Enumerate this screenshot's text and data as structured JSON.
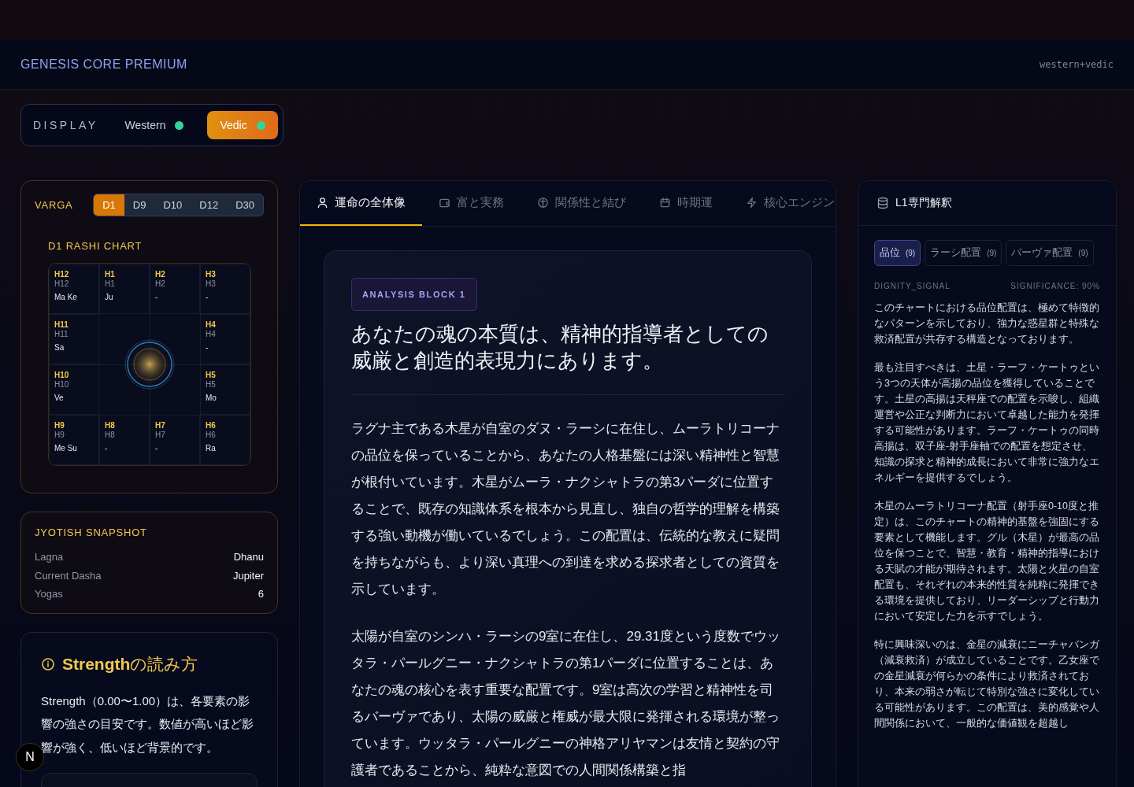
{
  "header": {
    "brand": "GENESIS CORE PREMIUM",
    "mode": "western+vedic"
  },
  "display": {
    "label": "DISPLAY",
    "options": [
      {
        "label": "Western",
        "selected": false,
        "color": "#34d399"
      },
      {
        "label": "Vedic",
        "selected": true,
        "color": "#34d399"
      }
    ]
  },
  "varga": {
    "label": "VARGA",
    "options": [
      {
        "label": "D1",
        "selected": true
      },
      {
        "label": "D9",
        "selected": false
      },
      {
        "label": "D10",
        "selected": false
      },
      {
        "label": "D12",
        "selected": false
      },
      {
        "label": "D30",
        "selected": false
      }
    ],
    "chart_title": "D1 RASHI CHART",
    "houses": [
      {
        "house": "H12",
        "sign": "H12",
        "planets": "Ma Ke"
      },
      {
        "house": "H1",
        "sign": "H1",
        "planets": "Ju"
      },
      {
        "house": "H2",
        "sign": "H2",
        "planets": "-"
      },
      {
        "house": "H3",
        "sign": "H3",
        "planets": "-"
      },
      {
        "house": "H11",
        "sign": "H11",
        "planets": "Sa"
      },
      {
        "house": "H4",
        "sign": "H4",
        "planets": "-"
      },
      {
        "house": "H10",
        "sign": "H10",
        "planets": "Ve"
      },
      {
        "house": "H5",
        "sign": "H5",
        "planets": "Mo"
      },
      {
        "house": "H9",
        "sign": "H9",
        "planets": "Me Su"
      },
      {
        "house": "H8",
        "sign": "H8",
        "planets": "-"
      },
      {
        "house": "H7",
        "sign": "H7",
        "planets": "-"
      },
      {
        "house": "H6",
        "sign": "H6",
        "planets": "Ra"
      }
    ]
  },
  "snapshot": {
    "title": "JYOTISH SNAPSHOT",
    "rows": [
      {
        "label": "Lagna",
        "value": "Dhanu"
      },
      {
        "label": "Current Dasha",
        "value": "Jupiter"
      },
      {
        "label": "Yogas",
        "value": "6"
      }
    ]
  },
  "strength": {
    "title": "**Strength**の読み方",
    "body": "Strength（0.00〜1.00）は、各要素の影響の強さの目安です。数値が高いほど影響が強く、低いほど背景的です。"
  },
  "tabs": [
    {
      "label": "運命の全体像",
      "selected": true
    },
    {
      "label": "富と実務",
      "selected": false
    },
    {
      "label": "関係性と結び",
      "selected": false
    },
    {
      "label": "時期運",
      "selected": false
    },
    {
      "label": "核心エンジン",
      "selected": false
    }
  ],
  "analysis": {
    "badge": "ANALYSIS BLOCK 1",
    "heading": "あなたの魂の本質は、精神的指導者としての威厳と創造的表現力にあります。",
    "paragraphs": [
      "ラグナ主である木星が自室のダヌ・ラーシに在住し、ムーラトリコーナの品位を保っていることから、あなたの人格基盤には深い精神性と智慧が根付いています。木星がムーラ・ナクシャトラの第3パーダに位置することで、既存の知識体系を根本から見直し、独自の哲学的理解を構築する強い動機が働いているでしょう。この配置は、伝統的な教えに疑問を持ちながらも、より深い真理への到達を求める探求者としての資質を示しています。",
      "太陽が自室のシンハ・ラーシの9室に在住し、29.31度という度数でウッタラ・パールグニー・ナクシャトラの第1パーダに位置することは、あなたの魂の核心を表す重要な配置です。9室は高次の学習と精神性を司るバーヴァであり、太陽の威厳と権威が最大限に発揮される環境が整っています。ウッタラ・パールグニーの神格アリヤマンは友情と契約の守護者であることから、純粋な意図での人間関係構築と指"
    ]
  },
  "expert": {
    "title": "L1専門解釈",
    "chips": [
      {
        "label": "品位",
        "count": "(9)",
        "selected": true
      },
      {
        "label": "ラーシ配置",
        "count": "(9)",
        "selected": false
      },
      {
        "label": "バーヴァ配置",
        "count": "(9)",
        "selected": false
      }
    ],
    "signal": "DIGNITY_SIGNAL",
    "significance": "SIGNIFICANCE: 90%",
    "paragraphs": [
      "このチャートにおける品位配置は、極めて特徴的なパターンを示しており、強力な惑星群と特殊な救済配置が共存する構造となっております。",
      "最も注目すべきは、土星・ラーフ・ケートゥという3つの天体が高揚の品位を獲得していることです。土星の高揚は天秤座での配置を示唆し、組織運営や公正な判断力において卓越した能力を発揮する可能性があります。ラーフ・ケートゥの同時高揚は、双子座-射手座軸での配置を想定させ、知識の探求と精神的成長において非常に強力なエネルギーを提供するでしょう。",
      "木星のムーラトリコーナ配置（射手座0-10度と推定）は、このチャートの精神的基盤を強固にする要素として機能します。グル（木星）が最高の品位を保つことで、智慧・教育・精神的指導における天賦の才能が期待されます。太陽と火星の自室配置も、それぞれの本来的性質を純粋に発揮できる環境を提供しており、リーダーシップと行動力において安定した力を示すでしょう。",
      "特に興味深いのは、金星の減衰にニーチャバンガ（減衰救済）が成立していることです。乙女座での金星減衰が何らかの条件により救済されており、本来の弱さが転じて特別な強さに変化している可能性があります。この配置は、美的感覚や人間関係において、一般的な価値観を超越し"
    ]
  },
  "dev_badge": "N"
}
